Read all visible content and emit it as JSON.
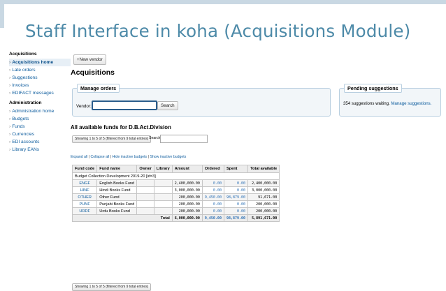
{
  "slide_title": "Staff Interface in koha (Acquisitions Module)",
  "sidebar": {
    "sections": [
      {
        "heading": "Acquisitions",
        "items": [
          "Acquisitions home",
          "Late orders",
          "Suggestions",
          "Invoices",
          "EDIFACT messages"
        ]
      },
      {
        "heading": "Administration",
        "items": [
          "Administration home",
          "Budgets",
          "Funds",
          "Currencies",
          "EDI accounts",
          "Library EANs"
        ]
      }
    ],
    "active_item": "Acquisitions home"
  },
  "toolbar": {
    "new_vendor_label": "+New vendor"
  },
  "page": {
    "heading": "Acquisitions"
  },
  "manage_orders": {
    "legend": "Manage orders",
    "vendor_label": "Vendor:",
    "vendor_value": "",
    "search_label": "Search"
  },
  "pending": {
    "legend": "Pending suggestions",
    "text": "354 suggestions waiting.",
    "link": "Manage suggestions."
  },
  "funds": {
    "heading": "All available funds for D.B.Act.Division",
    "showing": "Showing 1 to 5 of 5 (filtered from 9 total entries)",
    "search_label": "Search:",
    "search_value": "",
    "expand_all": "Expand all",
    "collapse_all": "Collapse all",
    "hide_inactive": "Hide inactive budgets",
    "show_inactive": "Show inactive budgets",
    "columns": [
      "Fund code",
      "Fund name",
      "Owner",
      "Library",
      "Amount",
      "Ordered",
      "Spent",
      "Total available"
    ],
    "group_row": "Budget Collection Development 2019-20 [id=3]",
    "rows": [
      {
        "code": "ENGF",
        "name": "English Books Fund",
        "owner": "",
        "library": "",
        "amount": "2,400,000.00",
        "ordered": "0.00",
        "spent": "0.00",
        "available": "2,400,000.00"
      },
      {
        "code": "HINF",
        "name": "Hindi Books Fund",
        "owner": "",
        "library": "",
        "amount": "3,000,000.00",
        "ordered": "0.00",
        "spent": "0.00",
        "available": "3,000,000.00"
      },
      {
        "code": "OTHER",
        "name": "Other Fund",
        "owner": "",
        "library": "",
        "amount": "200,000.00",
        "ordered": "9,450.00",
        "spent": "98,879.00",
        "available": "91,671.00"
      },
      {
        "code": "PUNF",
        "name": "Punjabi Books Fund",
        "owner": "",
        "library": "",
        "amount": "200,000.00",
        "ordered": "0.00",
        "spent": "0.00",
        "available": "200,000.00"
      },
      {
        "code": "URDF",
        "name": "Urdu Books Fund",
        "owner": "",
        "library": "",
        "amount": "200,000.00",
        "ordered": "0.00",
        "spent": "0.00",
        "available": "200,000.00"
      }
    ],
    "total": {
      "label": "Total",
      "amount": "6,000,000.00",
      "ordered": "9,450.00",
      "spent": "98,879.00",
      "available": "5,891,671.00"
    }
  }
}
